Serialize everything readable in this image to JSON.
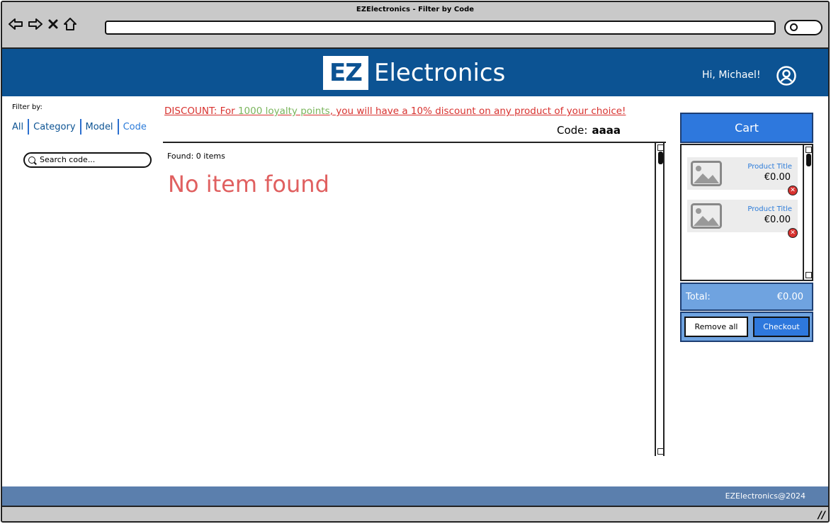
{
  "window": {
    "title": "EZElectronics - Filter by Code"
  },
  "header": {
    "logo_badge": "EZ",
    "logo_text": "Electronics",
    "greeting": "Hi, Michael!"
  },
  "filter": {
    "label": "Filter by:",
    "links": [
      "All",
      "Category",
      "Model",
      "Code"
    ],
    "active": "Code",
    "search_placeholder": "Search code..."
  },
  "discount": {
    "prefix": "DISCOUNT:  For ",
    "highlight": "1000 loyalty points",
    "suffix": ", you will have a 10% discount on any product of your choice!"
  },
  "code_filter": {
    "label": "Code:",
    "value": "aaaa"
  },
  "results": {
    "found_label": "Found:  0 items",
    "empty_message": "No item found"
  },
  "cart": {
    "title": "Cart",
    "items": [
      {
        "title": "Product Title",
        "price": "€0.00"
      },
      {
        "title": "Product Title",
        "price": "€0.00"
      }
    ],
    "total_label": "Total:",
    "total_value": "€0.00",
    "remove_all_label": "Remove all",
    "checkout_label": "Checkout"
  },
  "footer": {
    "text": "EZElectronics@2024"
  },
  "colors": {
    "header_bg": "#0c5393",
    "accent_blue": "#2e78dd",
    "discount_red": "#d8322f",
    "loyalty_green": "#7ab55c",
    "empty_message": "#e06060",
    "footer_bg": "#5b7fad"
  }
}
